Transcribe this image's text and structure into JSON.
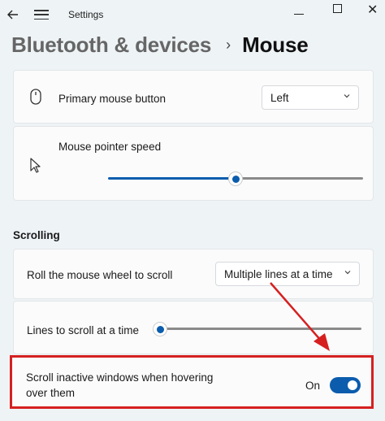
{
  "window": {
    "title": "Settings"
  },
  "breadcrumb": {
    "parent": "Bluetooth & devices",
    "separator": "›",
    "current": "Mouse"
  },
  "primary_button": {
    "label": "Primary mouse button",
    "value": "Left"
  },
  "pointer_speed": {
    "label": "Mouse pointer speed",
    "level": 0.5
  },
  "scrolling": {
    "section_title": "Scrolling",
    "roll": {
      "label": "Roll the mouse wheel to scroll",
      "value": "Multiple lines at a time"
    },
    "lines": {
      "label": "Lines to scroll at a time",
      "level": 0.0
    },
    "inactive": {
      "label_line1": "Scroll inactive windows when hovering",
      "label_line2": "over them",
      "state": "On"
    }
  },
  "colors": {
    "accent": "#0b5cad",
    "annotation": "#d62020"
  }
}
